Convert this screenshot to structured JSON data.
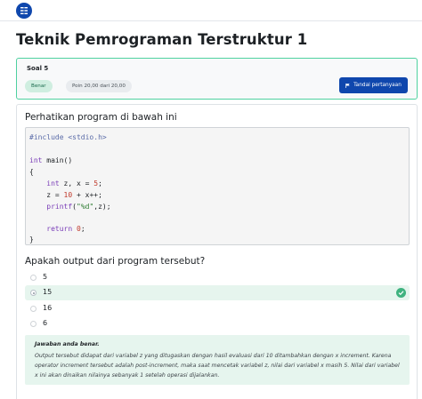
{
  "header": {
    "menu_icon": "menu-grid-icon",
    "accent": "#0f47ad"
  },
  "page": {
    "title": "Teknik Pemrograman Terstruktur 1"
  },
  "question_info": {
    "label": "Soal 5",
    "status_badge": "Benar",
    "points": "Poin 20,00 dari 20,00",
    "flag_button": "Tandai pertanyaan",
    "flag_icon": "flag-icon",
    "border_color": "#4fd1a0"
  },
  "question": {
    "prompt": "Perhatikan program di bawah ini",
    "code_lines": [
      "#include <stdio.h>",
      "",
      "int main()",
      "{",
      "    int z, x = 5;",
      "    z = 10 + x++;",
      "    printf(\"%d\",z);",
      "",
      "    return 0;",
      "}"
    ],
    "ask": "Apakah output dari program tersebut?",
    "options": [
      {
        "label": "5",
        "selected": false,
        "correct": false
      },
      {
        "label": "15",
        "selected": true,
        "correct": true
      },
      {
        "label": "16",
        "selected": false,
        "correct": false
      },
      {
        "label": "6",
        "selected": false,
        "correct": false
      }
    ]
  },
  "feedback": {
    "title": "Jawaban anda benar.",
    "text": "Output tersebut didapat dari variabel z yang ditugaskan dengan hasil evaluasi dari 10 ditambahkan dengan x increment. Karena operator increment tersebut adalah post-increment, maka saat mencetak variabel z, nilai dari variabel x masih 5. Nilai dari variabel x ini akan dinaikan nilainya sebanyak 1 setelah operasi dijalankan."
  }
}
